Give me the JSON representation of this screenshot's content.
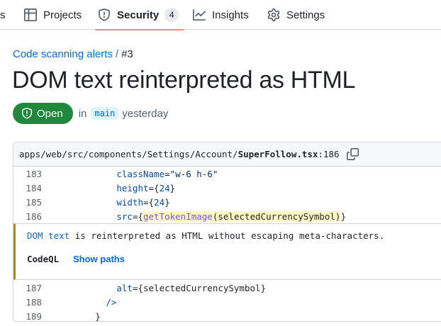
{
  "tabs": [
    {
      "label": "s",
      "icon": "code-icon"
    },
    {
      "label": "Projects",
      "icon": "table-icon"
    },
    {
      "label": "Security",
      "icon": "shield-icon",
      "count": "4",
      "selected": true
    },
    {
      "label": "Insights",
      "icon": "graph-icon"
    },
    {
      "label": "Settings",
      "icon": "gear-icon"
    }
  ],
  "breadcrumb": {
    "parent": "Code scanning alerts",
    "separator": "/",
    "current": "#3"
  },
  "title": "DOM text reinterpreted as HTML",
  "status": {
    "state": "Open",
    "prefix": "in",
    "branch": "main",
    "time": "yesterday"
  },
  "code": {
    "path": "apps/web/src/components/Settings/Account/",
    "file": "SuperFollow.tsx",
    "line_ref": ":186",
    "lines_before": [
      {
        "num": "183",
        "indent": "              ",
        "parts": [
          [
            "kw",
            "className"
          ],
          [
            "",
            "="
          ],
          [
            "str",
            "\"w-6 h-6\""
          ]
        ]
      },
      {
        "num": "184",
        "indent": "              ",
        "parts": [
          [
            "kw",
            "height"
          ],
          [
            "",
            "={"
          ],
          [
            "kw",
            "24"
          ],
          [
            "",
            "}"
          ]
        ]
      },
      {
        "num": "185",
        "indent": "              ",
        "parts": [
          [
            "kw",
            "width"
          ],
          [
            "",
            "={"
          ],
          [
            "kw",
            "24"
          ],
          [
            "",
            "}"
          ]
        ]
      },
      {
        "num": "186",
        "indent": "              ",
        "parts": [
          [
            "kw",
            "src"
          ],
          [
            "",
            "={"
          ],
          [
            "fn hl",
            "getTokenImage"
          ],
          [
            "hl",
            "(selectedCurrencySymbol)"
          ],
          [
            "",
            "}"
          ]
        ]
      }
    ],
    "lines_after": [
      {
        "num": "187",
        "indent": "              ",
        "parts": [
          [
            "kw",
            "alt"
          ],
          [
            "",
            "={selectedCurrencySymbol}"
          ]
        ]
      },
      {
        "num": "188",
        "indent": "            ",
        "parts": [
          [
            "kw",
            "/>"
          ]
        ]
      },
      {
        "num": "189",
        "indent": "          ",
        "parts": [
          [
            "",
            "}"
          ]
        ]
      }
    ]
  },
  "alert": {
    "source_link": "DOM text",
    "message": " is reinterpreted as HTML without escaping meta-characters.",
    "tool": "CodeQL",
    "paths_label": "Show paths",
    "accent": "#bf8700"
  },
  "colors": {
    "open": "#1f883d",
    "link": "#0969da",
    "tab_underline": "#fd8c73"
  }
}
